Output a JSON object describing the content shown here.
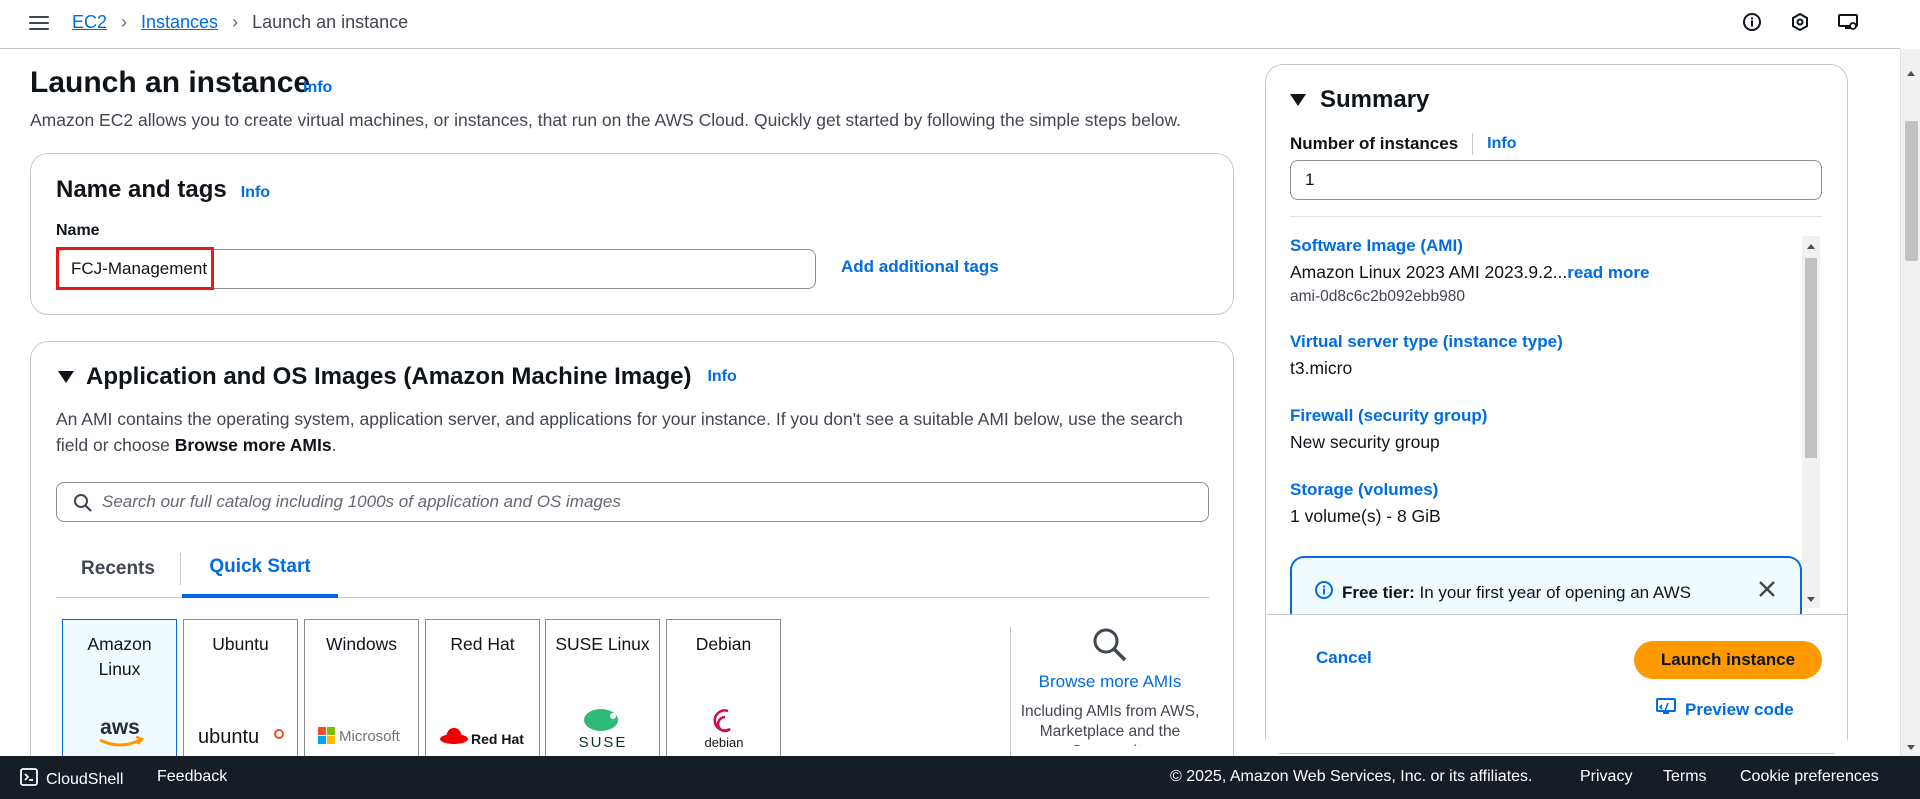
{
  "breadcrumb": {
    "ec2": "EC2",
    "instances": "Instances",
    "current": "Launch an instance"
  },
  "header_icons": [
    "info-circle-icon",
    "notifications-icon",
    "settings-icon"
  ],
  "page": {
    "title": "Launch an instance",
    "info": "Info",
    "description": "Amazon EC2 allows you to create virtual machines, or instances, that run on the AWS Cloud. Quickly get started by following the simple steps below."
  },
  "name_tags": {
    "title": "Name and tags",
    "info": "Info",
    "name_label": "Name",
    "name_value": "FCJ-Management",
    "add_tags": "Add additional tags"
  },
  "ami": {
    "title": "Application and OS Images (Amazon Machine Image)",
    "info": "Info",
    "desc_part1": "An AMI contains the operating system, application server, and applications for your instance. If you don't see a suitable AMI below, use the search field or choose ",
    "desc_bold": "Browse more AMIs",
    "desc_end": ".",
    "search_placeholder": "Search our full catalog including 1000s of application and OS images",
    "tabs": [
      "Recents",
      "Quick Start"
    ],
    "active_tab": "Quick Start",
    "os_cards": [
      {
        "name": "Amazon Linux",
        "logo": "aws"
      },
      {
        "name": "Ubuntu",
        "logo": "ubuntu"
      },
      {
        "name": "Windows",
        "logo": "Microsoft"
      },
      {
        "name": "Red Hat",
        "logo": "Red Hat"
      },
      {
        "name": "SUSE Linux",
        "logo": "SUSE"
      },
      {
        "name": "Debian",
        "logo": "debian"
      }
    ],
    "browse_more": "Browse more AMIs",
    "browse_sub": "Including AMIs from AWS, Marketplace and the Community"
  },
  "summary": {
    "title": "Summary",
    "num_instances_label": "Number of instances",
    "info": "Info",
    "num_instances_value": "1",
    "software_image_label": "Software Image (AMI)",
    "software_image_value": "Amazon Linux 2023 AMI 2023.9.2...",
    "read_more": "read more",
    "ami_id": "ami-0d8c6c2b092ebb980",
    "instance_type_label": "Virtual server type (instance type)",
    "instance_type_value": "t3.micro",
    "firewall_label": "Firewall (security group)",
    "firewall_value": "New security group",
    "storage_label": "Storage (volumes)",
    "storage_value": "1 volume(s) - 8 GiB",
    "free_tier_bold": "Free tier:",
    "free_tier_text": " In your first year of opening an AWS",
    "cancel": "Cancel",
    "launch": "Launch instance",
    "preview": "Preview code"
  },
  "footer": {
    "cloudshell": "CloudShell",
    "feedback": "Feedback",
    "copyright": "© 2025, Amazon Web Services, Inc. or its affiliates.",
    "privacy": "Privacy",
    "terms": "Terms",
    "cookies": "Cookie preferences"
  },
  "colors": {
    "accent": "#006ce0",
    "primary_button": "#ff9900",
    "footer_bg": "#161d26",
    "highlight": "#e01b1b"
  }
}
